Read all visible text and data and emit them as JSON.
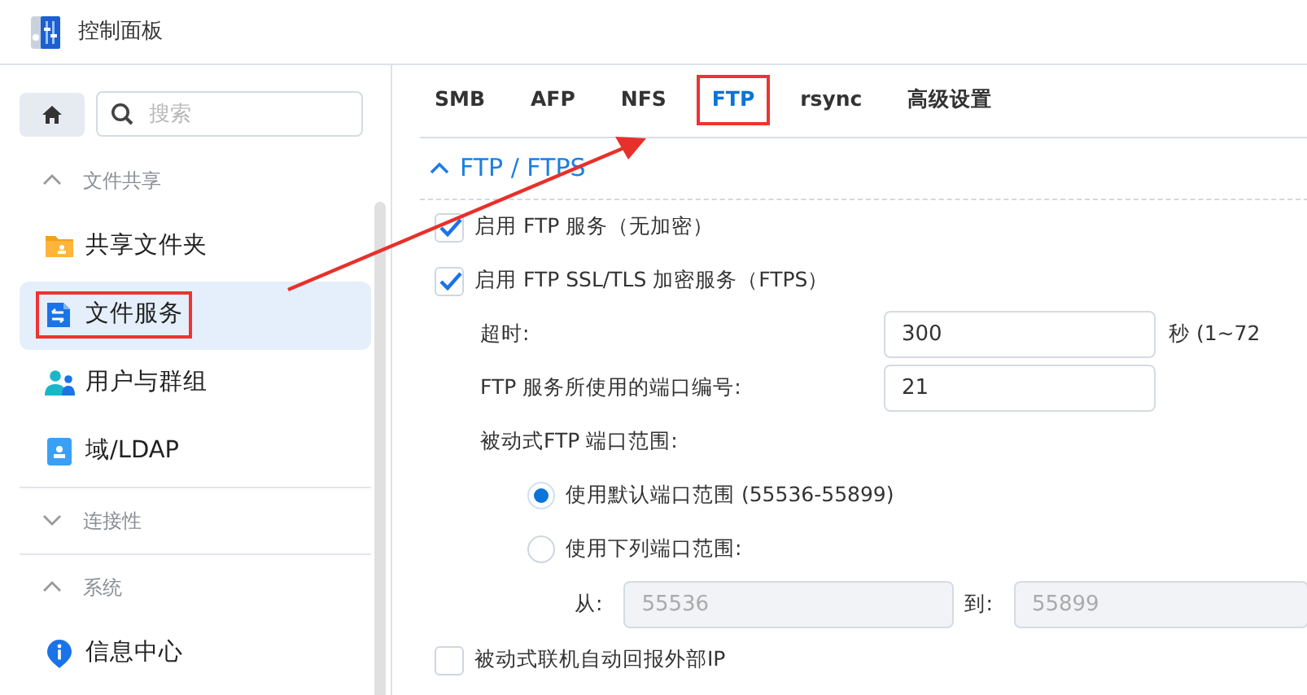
{
  "window": {
    "title": "控制面板"
  },
  "sidebar": {
    "search": {
      "placeholder": "搜索"
    },
    "sections": [
      {
        "title": "文件共享",
        "expanded": true,
        "items": [
          {
            "label": "共享文件夹",
            "selected": false,
            "highlighted": false
          },
          {
            "label": "文件服务",
            "selected": true,
            "highlighted": true
          },
          {
            "label": "用户与群组",
            "selected": false,
            "highlighted": false
          },
          {
            "label": "域/LDAP",
            "selected": false,
            "highlighted": false
          }
        ]
      },
      {
        "title": "连接性",
        "expanded": false
      },
      {
        "title": "系统",
        "expanded": true,
        "items": [
          {
            "label": "信息中心",
            "selected": false,
            "highlighted": false
          }
        ]
      }
    ]
  },
  "tabs": [
    {
      "label": "SMB",
      "selected": false,
      "highlighted": false
    },
    {
      "label": "AFP",
      "selected": false,
      "highlighted": false
    },
    {
      "label": "NFS",
      "selected": false,
      "highlighted": false
    },
    {
      "label": "FTP",
      "selected": true,
      "highlighted": true
    },
    {
      "label": "rsync",
      "selected": false,
      "highlighted": false
    },
    {
      "label": "高级设置",
      "selected": false,
      "highlighted": false
    }
  ],
  "panel": {
    "title": "FTP / FTPS",
    "expanded": true,
    "settings": [
      {
        "kind": "checkbox",
        "label": "启用 FTP 服务（无加密）",
        "checked": true
      },
      {
        "kind": "checkbox",
        "label": "启用 FTP SSL/TLS 加密服务（FTPS）",
        "checked": true
      },
      {
        "kind": "field",
        "label": "超时:",
        "value": "300",
        "unit": "秒 (1~72"
      },
      {
        "kind": "field",
        "label": "FTP 服务所使用的端口编号:",
        "value": "21"
      },
      {
        "kind": "label",
        "label": "被动式FTP 端口范围:"
      },
      {
        "kind": "radio",
        "label": "使用默认端口范围 (55536-55899)",
        "selected": true
      },
      {
        "kind": "radio",
        "label": "使用下列端口范围:",
        "selected": false
      },
      {
        "kind": "range",
        "from_label": "从:",
        "from": "55536",
        "to_label": "到:",
        "to": "55899",
        "disabled": true
      },
      {
        "kind": "checkbox",
        "label": "被动式联机自动回报外部IP",
        "checked": false
      }
    ]
  }
}
